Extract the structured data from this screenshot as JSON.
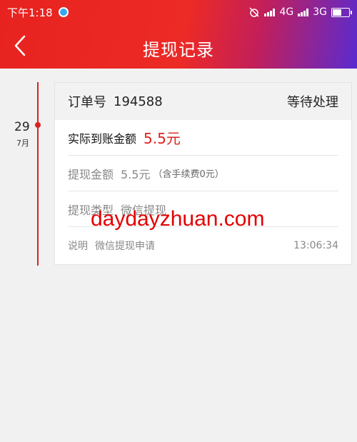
{
  "status_bar": {
    "time": "下午1:18",
    "network1": "4G",
    "network2": "3G"
  },
  "nav": {
    "title": "提现记录",
    "icons": [
      "back-arrow-icon"
    ]
  },
  "colors": {
    "accent": "#d9231e",
    "header_gradient_start": "#e8231f",
    "header_gradient_end": "#5a2bd0"
  },
  "records": [
    {
      "day": "29",
      "month": "7月",
      "order_label": "订单号",
      "order_no": "194588",
      "status": "等待处理",
      "actual_label": "实际到账金额",
      "actual_value": "5.5元",
      "amount_label": "提现金额",
      "amount_value": "5.5元",
      "fee_prefix": "（含手续费",
      "fee_value": "0元",
      "fee_suffix": "）",
      "type_label": "提现类型",
      "type_value": "微信提现",
      "note_label": "说明",
      "note_value": "微信提现申请",
      "time": "13:06:34"
    }
  ],
  "watermark": "daydayzhuan.com"
}
